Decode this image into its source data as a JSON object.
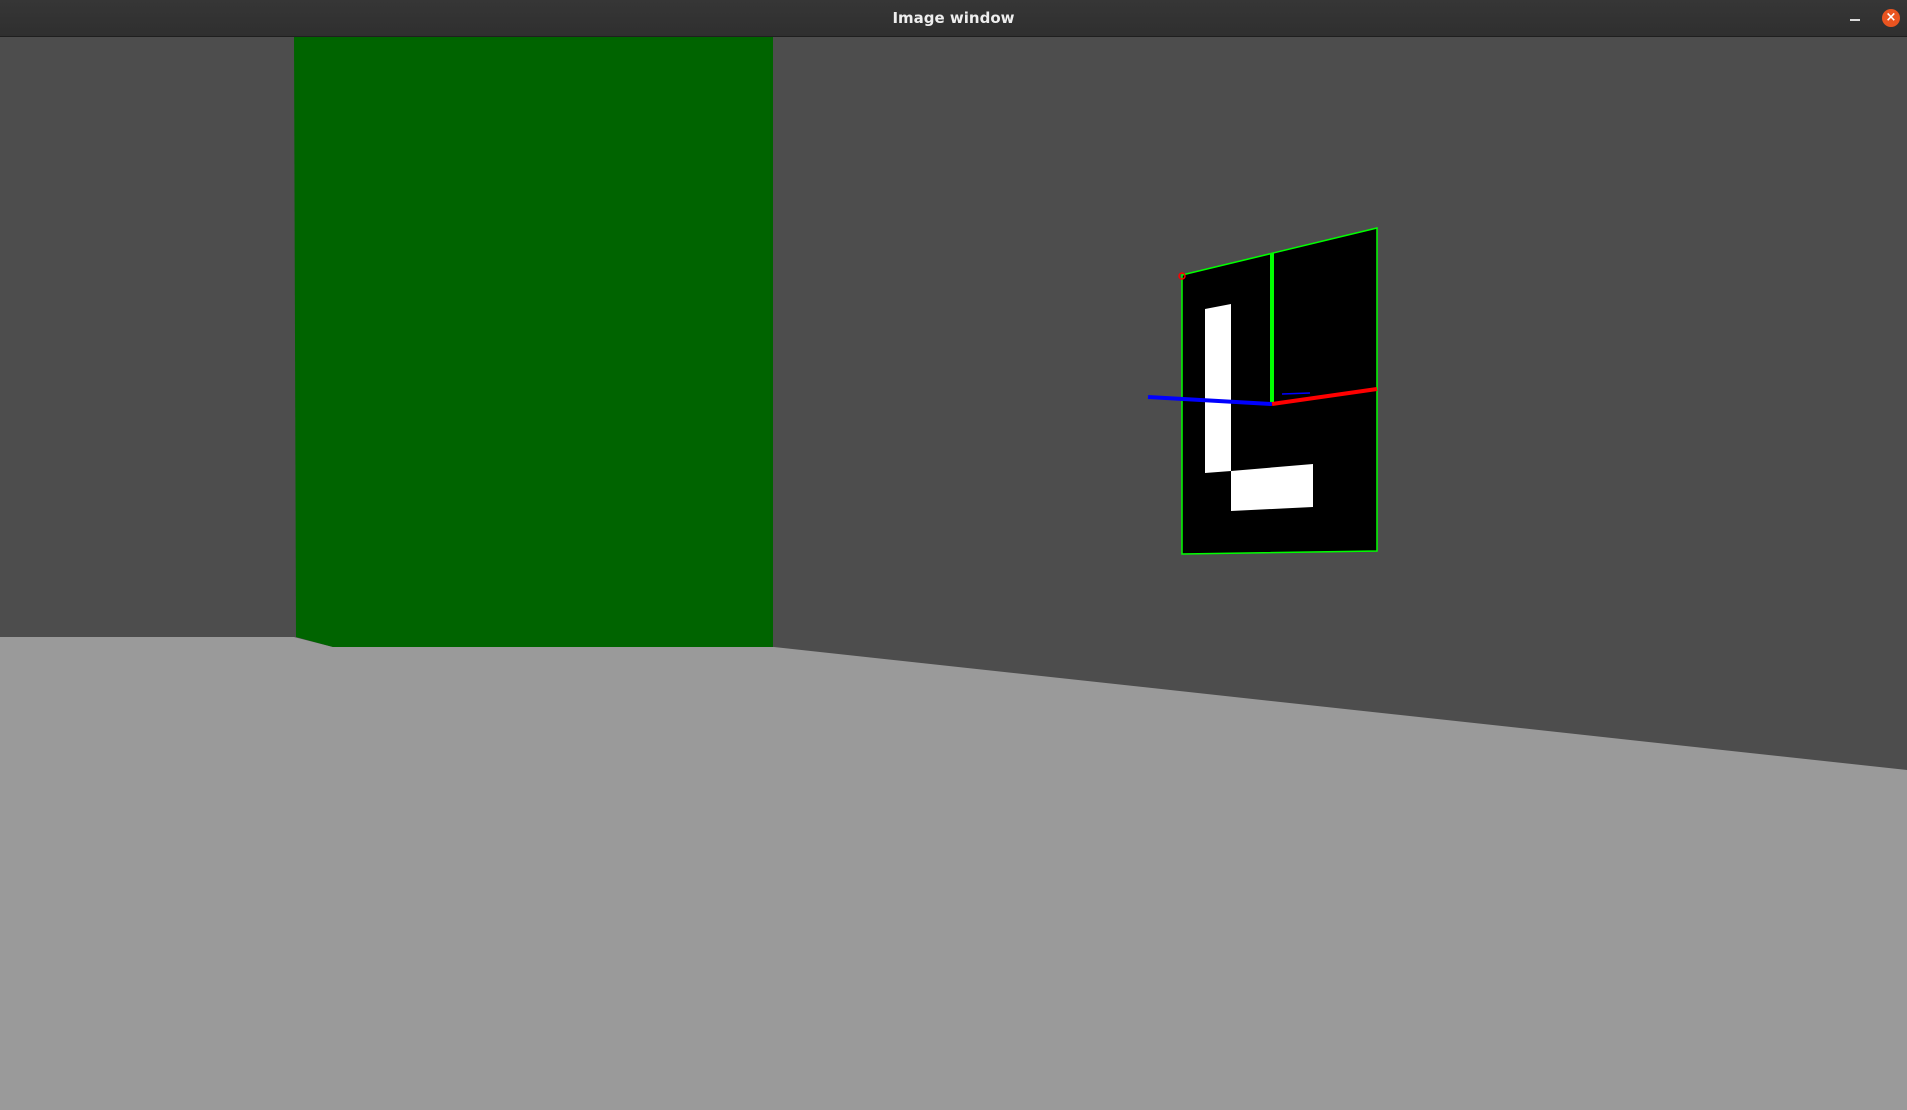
{
  "window": {
    "title": "Image window",
    "minimize_glyph": "–",
    "close_glyph": "×"
  },
  "scene": {
    "wall_color": "#4d4d4d",
    "floor_color": "#9a9a9a",
    "green_panel_color": "#006400",
    "marker_background": "#000000",
    "marker_foreground": "#ffffff",
    "marker_outline_color": "#00ff00",
    "axis_x_color": "#ff0000",
    "axis_y_color": "#00ff00",
    "axis_z_color": "#0000ff",
    "corner_marker_color": "#ff0000"
  }
}
